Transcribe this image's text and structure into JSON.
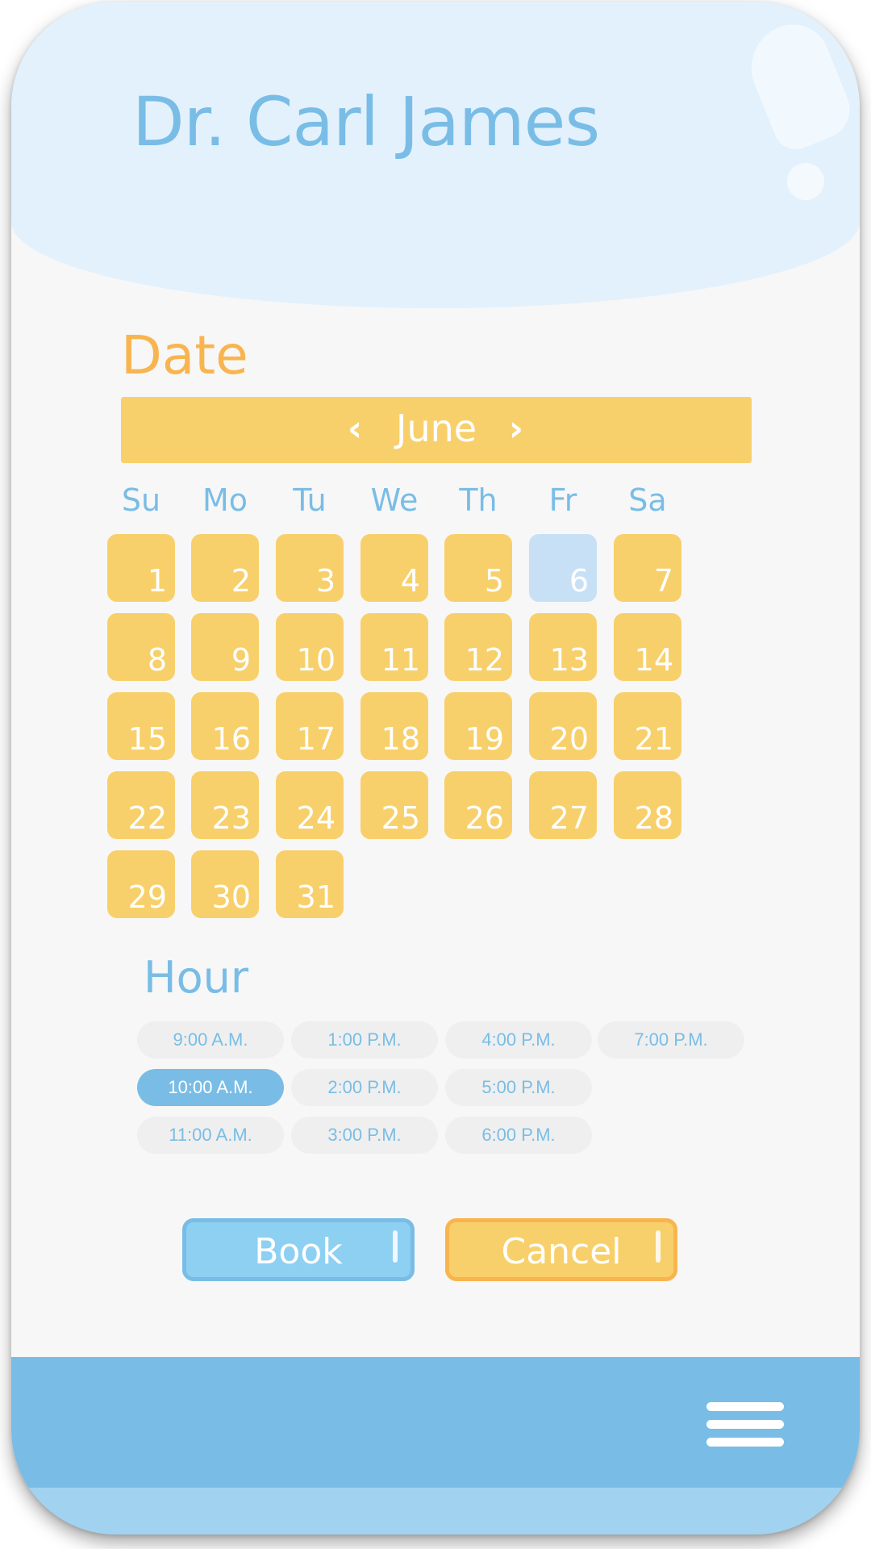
{
  "doctor": {
    "name": "Dr. Carl James"
  },
  "date_section": {
    "title": "Date",
    "month": "June",
    "weekdays": [
      "Su",
      "Mo",
      "Tu",
      "We",
      "Th",
      "Fr",
      "Sa"
    ],
    "days": [
      "1",
      "2",
      "3",
      "4",
      "5",
      "6",
      "7",
      "8",
      "9",
      "10",
      "11",
      "12",
      "13",
      "14",
      "15",
      "16",
      "17",
      "18",
      "19",
      "20",
      "21",
      "22",
      "23",
      "24",
      "25",
      "26",
      "27",
      "28",
      "29",
      "30",
      "31"
    ],
    "selected_day": "6"
  },
  "hour_section": {
    "title": "Hour",
    "slots": [
      "9:00 A.M.",
      "10:00 A.M.",
      "11:00 A.M.",
      "1:00 P.M.",
      "2:00 P.M.",
      "3:00 P.M.",
      "4:00 P.M.",
      "5:00 P.M.",
      "6:00 P.M.",
      "7:00 P.M."
    ],
    "selected_slot": "10:00 A.M."
  },
  "actions": {
    "book_label": "Book",
    "cancel_label": "Cancel"
  },
  "icons": {
    "prev": "chevron-left-icon",
    "next": "chevron-right-icon",
    "menu": "hamburger-menu-icon"
  },
  "colors": {
    "accent_blue": "#79bde6",
    "accent_yellow": "#f8d06b",
    "accent_orange": "#f8b54f",
    "selected_day": "#c8e0f6"
  }
}
